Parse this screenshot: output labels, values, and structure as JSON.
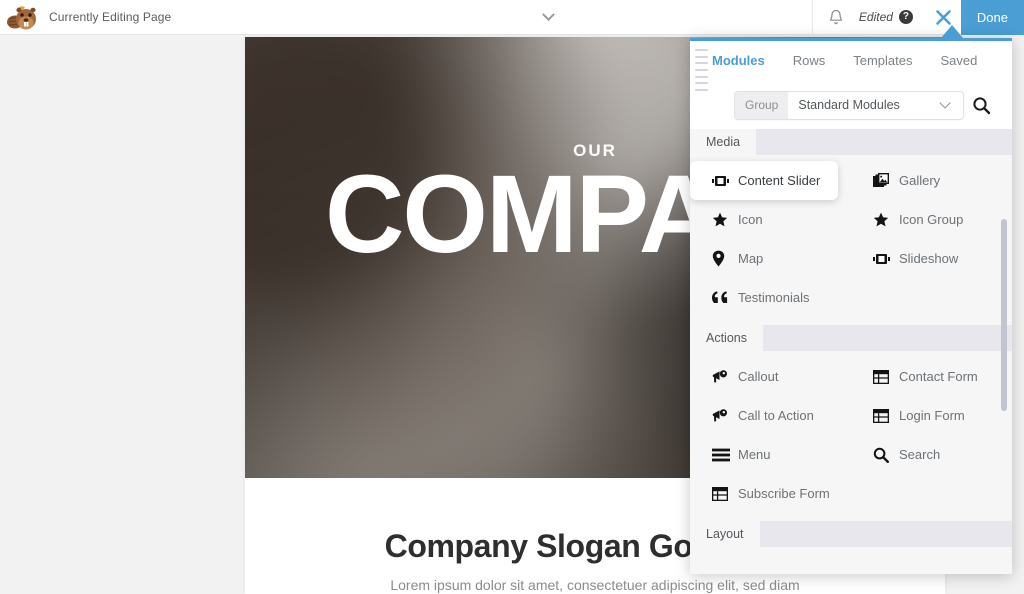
{
  "topbar": {
    "logo_name": "beaver-builder-logo",
    "title": "Currently Editing Page",
    "chevron_icon": "chevron-down-icon",
    "bell_icon": "bell-icon",
    "edited_label": "Edited",
    "help_icon_label": "?",
    "close_icon": "close-icon",
    "done_label": "Done"
  },
  "page": {
    "hero_kicker": "OUR",
    "hero_title": "COMPANY",
    "slogan": "Company Slogan Goes Here",
    "subtext": "Lorem ipsum dolor sit amet, consectetuer adipiscing elit, sed diam"
  },
  "panel": {
    "tabs": [
      {
        "label": "Modules",
        "active": true
      },
      {
        "label": "Rows",
        "active": false
      },
      {
        "label": "Templates",
        "active": false
      },
      {
        "label": "Saved",
        "active": false
      }
    ],
    "group_label": "Group",
    "group_value": "Standard Modules",
    "search_icon": "search-icon",
    "sections": [
      {
        "name": "Media",
        "items": [
          {
            "label": "Content Slider",
            "icon": "content-slider-icon",
            "state": "dragging"
          },
          {
            "label": "Gallery",
            "icon": "gallery-icon",
            "state": "normal"
          },
          {
            "label": "Icon",
            "icon": "star-icon",
            "state": "normal"
          },
          {
            "label": "Icon Group",
            "icon": "star-icon",
            "state": "normal"
          },
          {
            "label": "Map",
            "icon": "map-pin-icon",
            "state": "normal"
          },
          {
            "label": "Slideshow",
            "icon": "slideshow-icon",
            "state": "normal"
          },
          {
            "label": "Testimonials",
            "icon": "quote-icon",
            "state": "normal"
          }
        ]
      },
      {
        "name": "Actions",
        "items": [
          {
            "label": "Callout",
            "icon": "megaphone-icon",
            "state": "normal"
          },
          {
            "label": "Contact Form",
            "icon": "form-icon",
            "state": "normal"
          },
          {
            "label": "Call to Action",
            "icon": "megaphone-icon",
            "state": "normal"
          },
          {
            "label": "Login Form",
            "icon": "form-icon",
            "state": "normal"
          },
          {
            "label": "Menu",
            "icon": "hamburger-icon",
            "state": "normal"
          },
          {
            "label": "Search",
            "icon": "search-icon",
            "state": "normal"
          },
          {
            "label": "Subscribe Form",
            "icon": "form-icon",
            "state": "normal"
          }
        ]
      },
      {
        "name": "Layout",
        "items": []
      }
    ]
  },
  "colors": {
    "accent": "#4a9ed4",
    "panel_bg": "#f6f6f7",
    "section_bg": "#e7e7ed",
    "text": "#6d7276"
  }
}
